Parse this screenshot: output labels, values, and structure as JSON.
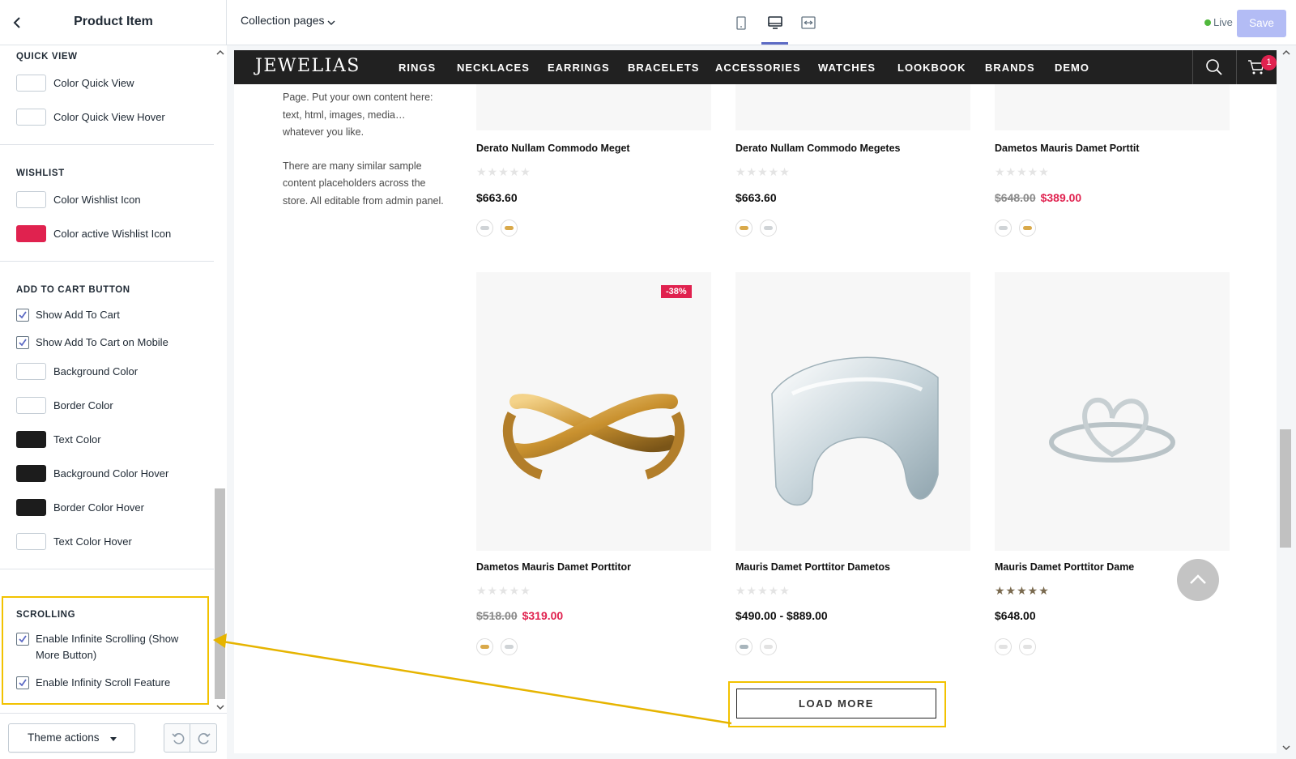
{
  "sidebar": {
    "title": "Product Item",
    "sections": {
      "quick_view": {
        "title": "QUICK VIEW",
        "items": [
          "Color Quick View",
          "Color Quick View Hover"
        ]
      },
      "wishlist": {
        "title": "WISHLIST",
        "items": [
          "Color Wishlist Icon",
          "Color active Wishlist Icon"
        ]
      },
      "add_to_cart": {
        "title": "ADD TO CART BUTTON",
        "checkboxes": [
          "Show Add To Cart",
          "Show Add To Cart on Mobile"
        ],
        "items": [
          "Background Color",
          "Border Color",
          "Text Color",
          "Background Color Hover",
          "Border Color Hover",
          "Text Color Hover"
        ]
      },
      "scrolling": {
        "title": "SCROLLING",
        "checkboxes": [
          "Enable Infinite Scrolling (Show More Button)",
          "Enable Infinity Scroll Feature"
        ]
      }
    },
    "footer": {
      "theme_actions": "Theme actions"
    }
  },
  "colors": {
    "white": "#ffffff",
    "wishlist_active": "#e0224f",
    "black": "#1c1c1c",
    "accent": "#5c6ac4",
    "highlight": "#f2c200"
  },
  "topbar": {
    "page_select": "Collection pages",
    "live_label": "Live",
    "save_label": "Save"
  },
  "store": {
    "logo": "JEWELIAS",
    "nav": [
      "RINGS",
      "NECKLACES",
      "EARRINGS",
      "BRACELETS",
      "ACCESSORIES",
      "WATCHES",
      "LOOKBOOK",
      "BRANDS",
      "DEMO"
    ],
    "cart_count": "1",
    "intro_line1": "Page. Put your own content here: text, html, images, media… whatever you like.",
    "intro_line2": "There are many similar sample content placeholders across the store. All editable from admin panel.",
    "products_row1": [
      {
        "name": "Derato Nullam Commodo Meget",
        "price": "$663.60",
        "old_price": "",
        "sale_price": ""
      },
      {
        "name": "Derato Nullam Commodo Megetes",
        "price": "$663.60",
        "old_price": "",
        "sale_price": ""
      },
      {
        "name": "Dametos Mauris Damet Porttit",
        "price": "",
        "old_price": "$648.00",
        "sale_price": "$389.00"
      }
    ],
    "products_row2": [
      {
        "name": "Dametos Mauris Damet Porttitor",
        "price": "",
        "old_price": "$518.00",
        "sale_price": "$319.00",
        "badge": "-38%",
        "rating": 0
      },
      {
        "name": "Mauris Damet Porttitor Dametos",
        "price": "$490.00 - $889.00",
        "old_price": "",
        "sale_price": "",
        "rating": 0
      },
      {
        "name": "Mauris Damet Porttitor Dame",
        "price": "$648.00",
        "old_price": "",
        "sale_price": "",
        "rating": 5
      }
    ],
    "stars": "★★★★★",
    "load_more": "LOAD MORE"
  },
  "icons": {
    "back": "chevron-left-icon",
    "mobile": "mobile-icon",
    "desktop": "desktop-icon",
    "fullscreen": "fullscreen-icon",
    "search": "search-icon",
    "cart": "cart-icon",
    "undo": "undo-icon",
    "redo": "redo-icon",
    "scroll_top": "chevron-up-icon"
  }
}
